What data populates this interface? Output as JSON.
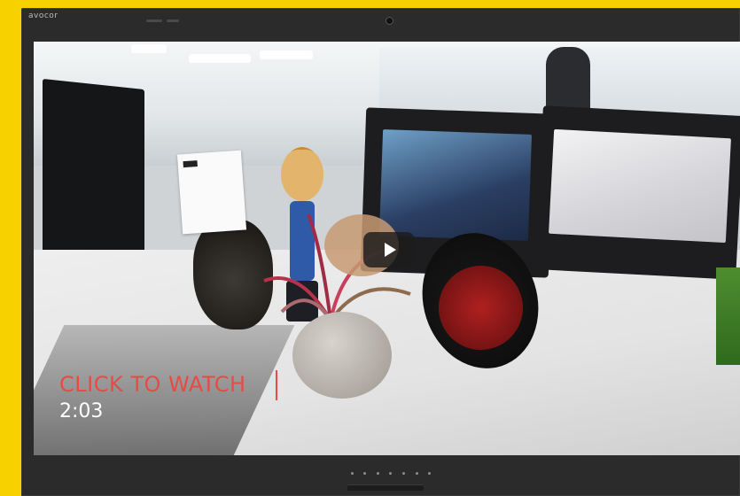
{
  "device": {
    "brand": "avocor"
  },
  "video": {
    "call_to_action": "CLICK TO WATCH",
    "duration": "2:03",
    "play_icon": "play-icon"
  },
  "colors": {
    "page_background": "#f7d200",
    "accent": "#e94a45",
    "bezel": "#2b2b2b"
  }
}
